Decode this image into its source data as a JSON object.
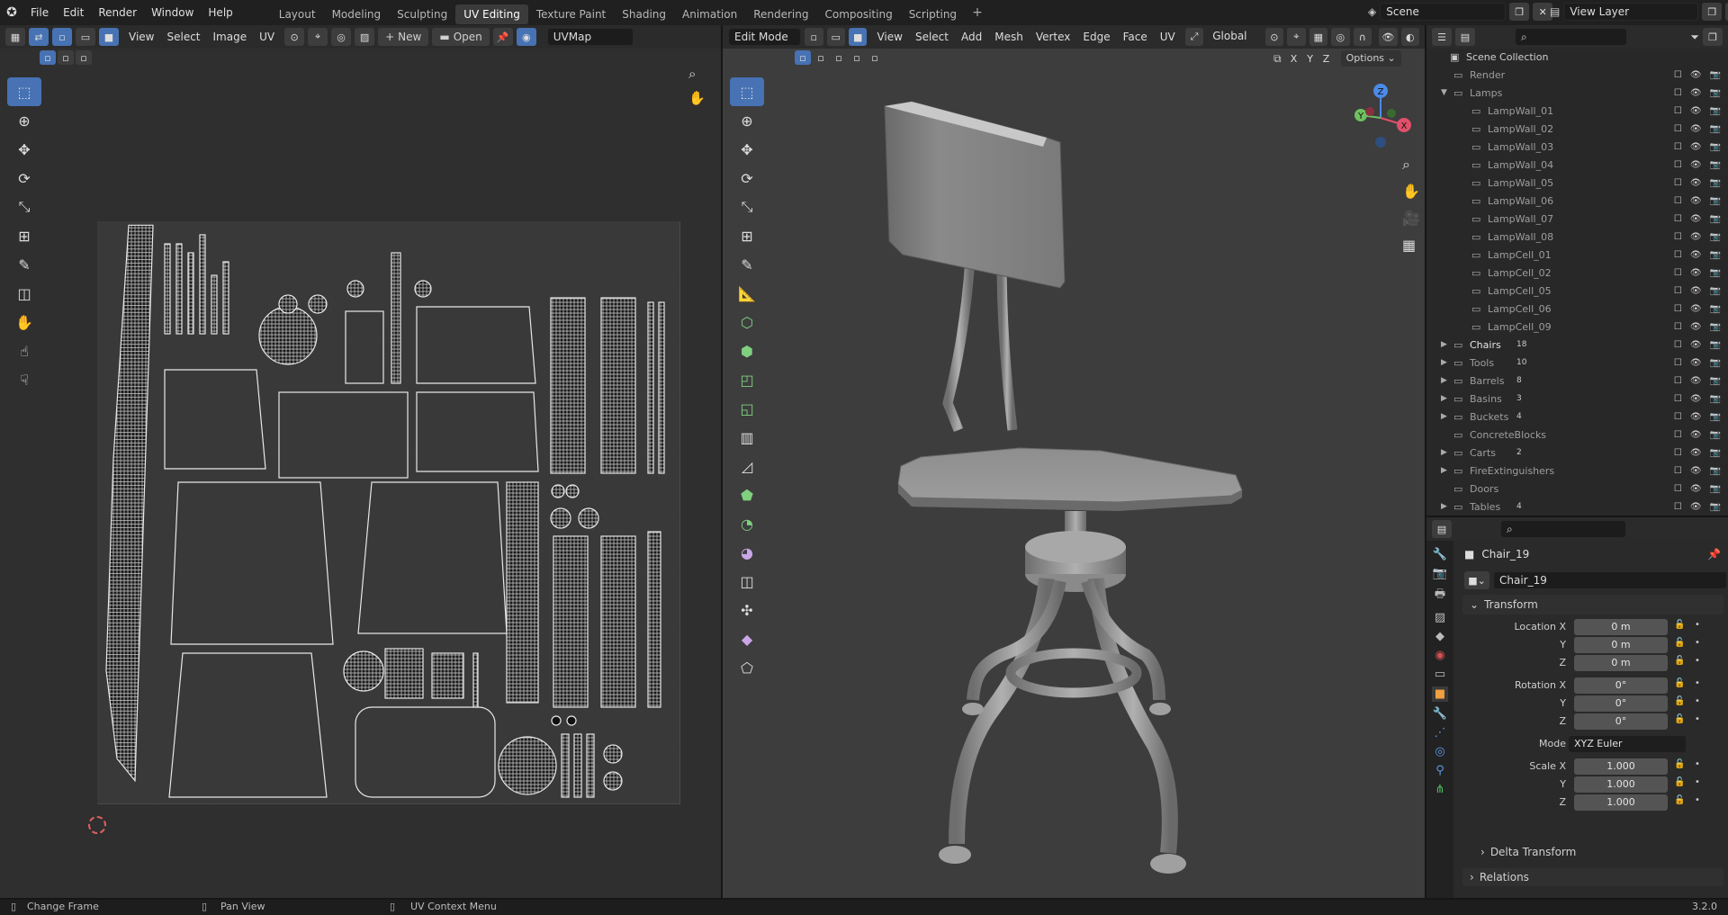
{
  "topbar": {
    "menus": [
      "File",
      "Edit",
      "Render",
      "Window",
      "Help"
    ],
    "workspaces": [
      "Layout",
      "Modeling",
      "Sculpting",
      "UV Editing",
      "Texture Paint",
      "Shading",
      "Animation",
      "Rendering",
      "Compositing",
      "Scripting"
    ],
    "active_workspace": "UV Editing",
    "add_tab": "+",
    "scene": "Scene",
    "view_layer": "View Layer"
  },
  "uv_editor": {
    "menus": [
      "View",
      "Select",
      "Image",
      "UV"
    ],
    "new_label": "New",
    "open_label": "Open",
    "uvmap": "UVMap"
  },
  "viewport": {
    "mode": "Edit Mode",
    "menus": [
      "View",
      "Select",
      "Add",
      "Mesh",
      "Vertex",
      "Edge",
      "Face",
      "UV"
    ],
    "orientation": "Global",
    "options_label": "Options",
    "axes": [
      "X",
      "Y",
      "Z"
    ],
    "gizmo": {
      "x": "X",
      "y": "Y",
      "z": "Z"
    }
  },
  "outliner": {
    "root": "Scene Collection",
    "items": [
      {
        "label": "Render",
        "depth": 1,
        "count": ""
      },
      {
        "label": "Lamps",
        "depth": 1,
        "count": "",
        "expanded": true
      },
      {
        "label": "LampWall_01",
        "depth": 2,
        "count": ""
      },
      {
        "label": "LampWall_02",
        "depth": 2,
        "count": ""
      },
      {
        "label": "LampWall_03",
        "depth": 2,
        "count": ""
      },
      {
        "label": "LampWall_04",
        "depth": 2,
        "count": ""
      },
      {
        "label": "LampWall_05",
        "depth": 2,
        "count": ""
      },
      {
        "label": "LampWall_06",
        "depth": 2,
        "count": ""
      },
      {
        "label": "LampWall_07",
        "depth": 2,
        "count": ""
      },
      {
        "label": "LampWall_08",
        "depth": 2,
        "count": ""
      },
      {
        "label": "LampCell_01",
        "depth": 2,
        "count": ""
      },
      {
        "label": "LampCell_02",
        "depth": 2,
        "count": ""
      },
      {
        "label": "LampCell_05",
        "depth": 2,
        "count": ""
      },
      {
        "label": "LampCell_06",
        "depth": 2,
        "count": ""
      },
      {
        "label": "LampCell_09",
        "depth": 2,
        "count": ""
      },
      {
        "label": "Chairs",
        "depth": 1,
        "count": "18",
        "bright": true
      },
      {
        "label": "Tools",
        "depth": 1,
        "count": "10"
      },
      {
        "label": "Barrels",
        "depth": 1,
        "count": "8"
      },
      {
        "label": "Basins",
        "depth": 1,
        "count": "3"
      },
      {
        "label": "Buckets",
        "depth": 1,
        "count": "4"
      },
      {
        "label": "ConcreteBlocks",
        "depth": 1,
        "count": ""
      },
      {
        "label": "Carts",
        "depth": 1,
        "count": "2"
      },
      {
        "label": "FireExtinguishers",
        "depth": 1,
        "count": ""
      },
      {
        "label": "Doors",
        "depth": 1,
        "count": ""
      },
      {
        "label": "Tables",
        "depth": 1,
        "count": "4"
      }
    ]
  },
  "properties": {
    "object_name": "Chair_19",
    "data_name": "Chair_19",
    "transform_title": "Transform",
    "location": {
      "label": "Location X",
      "y": "Y",
      "z": "Z",
      "x_val": "0 m",
      "y_val": "0 m",
      "z_val": "0 m"
    },
    "rotation": {
      "label": "Rotation X",
      "y": "Y",
      "z": "Z",
      "x_val": "0°",
      "y_val": "0°",
      "z_val": "0°"
    },
    "mode": {
      "label": "Mode",
      "value": "XYZ Euler"
    },
    "scale": {
      "label": "Scale X",
      "y": "Y",
      "z": "Z",
      "x_val": "1.000",
      "y_val": "1.000",
      "z_val": "1.000"
    },
    "delta_transform": "Delta Transform",
    "relations": "Relations"
  },
  "statusbar": {
    "change_frame": "Change Frame",
    "pan_view": "Pan View",
    "uv_context": "UV Context Menu",
    "version": "3.2.0"
  }
}
